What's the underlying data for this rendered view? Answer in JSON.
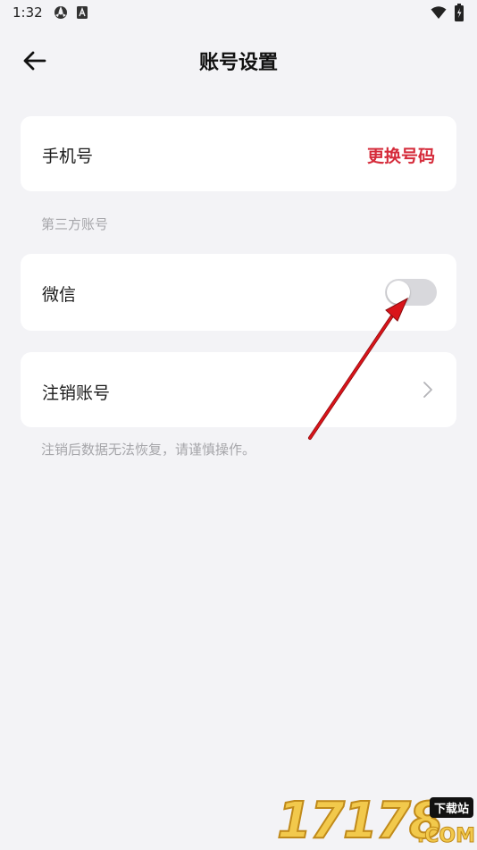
{
  "status_bar": {
    "time": "1:32",
    "icons": [
      "android-system-icon",
      "font-a-icon",
      "wifi-icon",
      "battery-icon"
    ]
  },
  "header": {
    "title": "账号设置",
    "back_icon": "arrow-left-icon"
  },
  "phone_row": {
    "label": "手机号",
    "action": "更换号码",
    "action_color": "#d52b3a"
  },
  "third_party": {
    "section_label": "第三方账号",
    "wechat": {
      "label": "微信",
      "toggle_on": false
    }
  },
  "cancel_row": {
    "label": "注销账号",
    "chevron_icon": "chevron-right-icon"
  },
  "footnote": "注销后数据无法恢复，请谨慎操作。",
  "annotation": {
    "type": "arrow",
    "color": "#d9141a",
    "points_to": "wechat-toggle"
  },
  "watermark": {
    "digits": "17178",
    "badge": "下载站",
    "suffix": ".COM"
  }
}
